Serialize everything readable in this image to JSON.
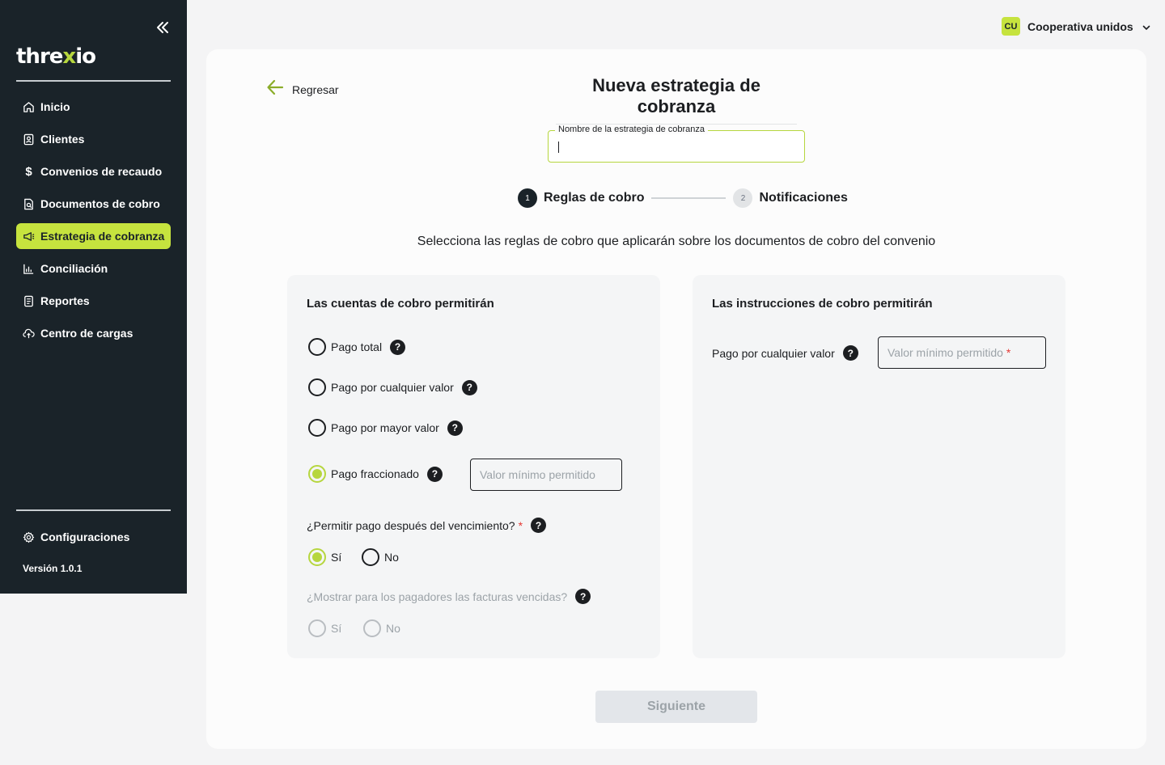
{
  "sidebar": {
    "logo": {
      "part1": "thre",
      "part2": "x",
      "part3": "io"
    },
    "items": [
      {
        "label": "Inicio",
        "icon": "home-icon"
      },
      {
        "label": "Clientes",
        "icon": "clients-icon"
      },
      {
        "label": "Convenios de recaudo",
        "icon": "dollar-icon"
      },
      {
        "label": "Documentos de cobro",
        "icon": "document-search-icon"
      },
      {
        "label": "Estrategia de cobranza",
        "icon": "megaphone-icon",
        "active": true
      },
      {
        "label": "Conciliación",
        "icon": "chart-icon"
      },
      {
        "label": "Reportes",
        "icon": "report-icon"
      },
      {
        "label": "Centro de cargas",
        "icon": "cloud-upload-icon"
      }
    ],
    "settings_label": "Configuraciones",
    "version": "Versión 1.0.1"
  },
  "user": {
    "initials": "CU",
    "name": "Cooperativa unidos"
  },
  "page": {
    "back_label": "Regresar",
    "title": "Nueva estrategia de cobranza",
    "name_field_label": "Nombre de la estrategia de cobranza",
    "name_field_value": "",
    "steps": [
      {
        "num": "1",
        "label": "Reglas de cobro"
      },
      {
        "num": "2",
        "label": "Notificaciones"
      }
    ],
    "subtitle": "Selecciona las reglas de cobro que aplicarán sobre los documentos de cobro del convenio",
    "left_panel": {
      "title": "Las cuentas de cobro permitirán",
      "options": [
        "Pago total",
        "Pago por cualquier valor",
        "Pago por mayor valor",
        "Pago fraccionado"
      ],
      "fraction_placeholder": "Valor mínimo permitido",
      "q1": "¿Permitir pago después del vencimiento?",
      "q2": "¿Mostrar para los pagadores las facturas vencidas?",
      "yes": "Sí",
      "no": "No"
    },
    "right_panel": {
      "title": "Las instrucciones de cobro permitirán",
      "option": "Pago por cualquier valor",
      "placeholder": "Valor mínimo permitido"
    },
    "next_label": "Siguiente"
  },
  "colors": {
    "sidebar_bg": "#1a2329",
    "accent": "#c6e33e",
    "required": "#e53935"
  }
}
